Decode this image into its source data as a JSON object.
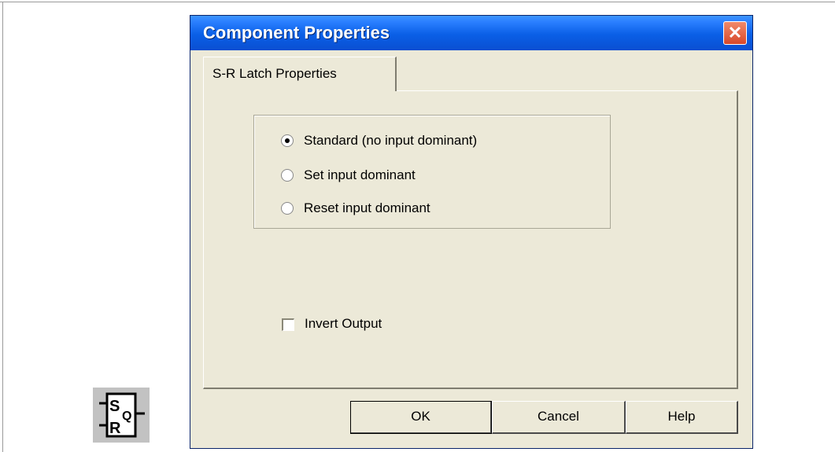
{
  "dialog": {
    "title": "Component Properties",
    "close_glyph": "✕",
    "tab_label": "S-R Latch Properties",
    "dominance_options": [
      {
        "label": "Standard (no input dominant)",
        "checked": true
      },
      {
        "label": "Set input dominant",
        "checked": false
      },
      {
        "label": "Reset input dominant",
        "checked": false
      }
    ],
    "invert_output": {
      "label": "Invert Output",
      "checked": false
    },
    "buttons": {
      "ok": "OK",
      "cancel": "Cancel",
      "help": "Help"
    }
  },
  "latch_symbol": {
    "set": "S",
    "reset": "R",
    "output": "Q"
  },
  "colors": {
    "titlebar": "#0a5fe6",
    "dialog_bg": "#ece9d8",
    "close_button": "#d8482a"
  }
}
